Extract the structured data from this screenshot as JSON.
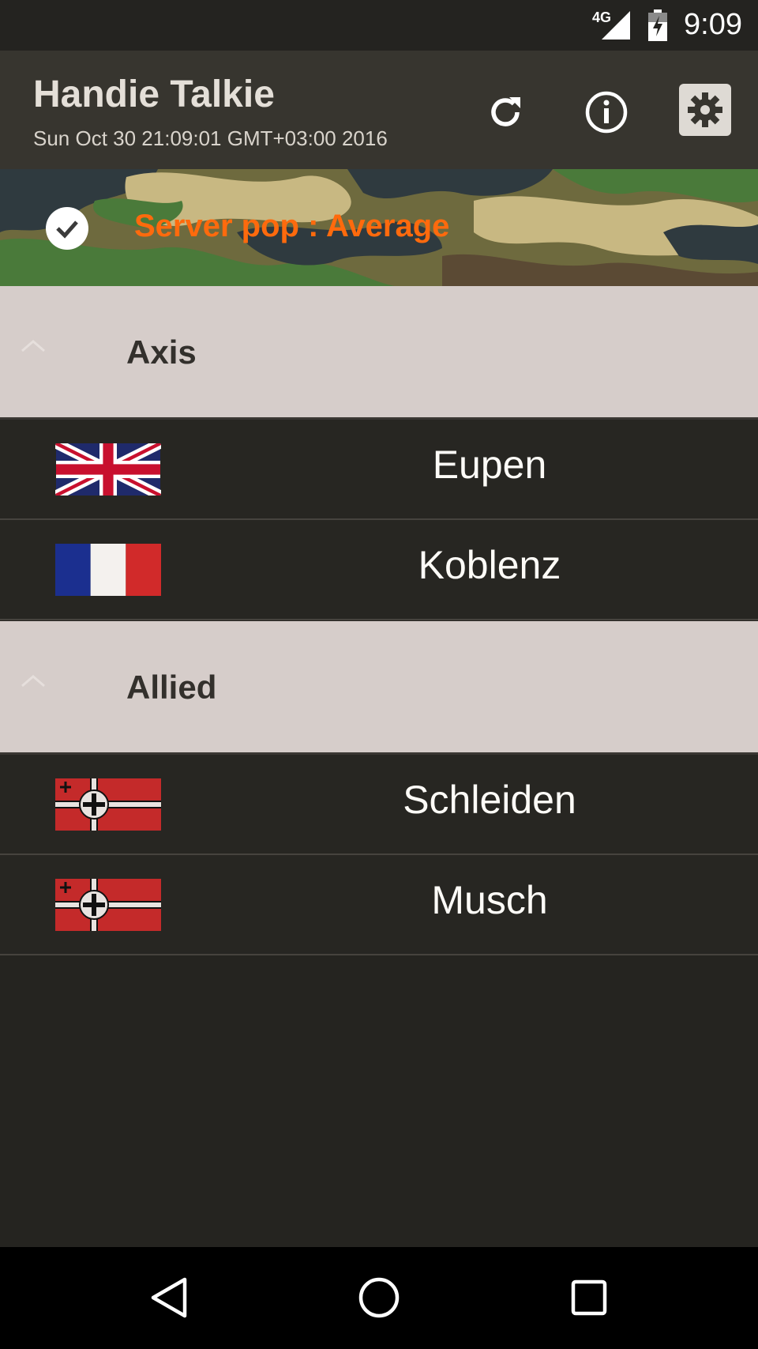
{
  "status_bar": {
    "network_label": "4G",
    "time": "9:09",
    "signal_icon": "cell-signal-icon",
    "battery_icon": "battery-charging-icon"
  },
  "app_bar": {
    "title": "Handie Talkie",
    "subtitle": "Sun Oct 30 21:09:01 GMT+03:00 2016",
    "actions": [
      {
        "icon": "refresh-icon"
      },
      {
        "icon": "info-icon"
      },
      {
        "icon": "settings-gear-icon"
      }
    ]
  },
  "banner": {
    "status_icon": "check-circle-icon",
    "text": "Server pop : Average",
    "text_color": "#ff6a0d"
  },
  "groups": [
    {
      "label": "Axis",
      "items": [
        {
          "name": "Eupen",
          "flag": "united-kingdom-flag"
        },
        {
          "name": "Koblenz",
          "flag": "france-flag"
        }
      ]
    },
    {
      "label": "Allied",
      "items": [
        {
          "name": "Schleiden",
          "flag": "german-war-ensign-flag"
        },
        {
          "name": "Musch",
          "flag": "german-war-ensign-flag"
        }
      ]
    }
  ],
  "nav_bar": {
    "buttons": [
      "back-icon",
      "home-icon",
      "recents-icon"
    ]
  },
  "colors": {
    "header_bg": "#37352f",
    "group_bg": "#d6cdca",
    "row_bg": "#272622",
    "accent_orange": "#ff6a0d"
  }
}
